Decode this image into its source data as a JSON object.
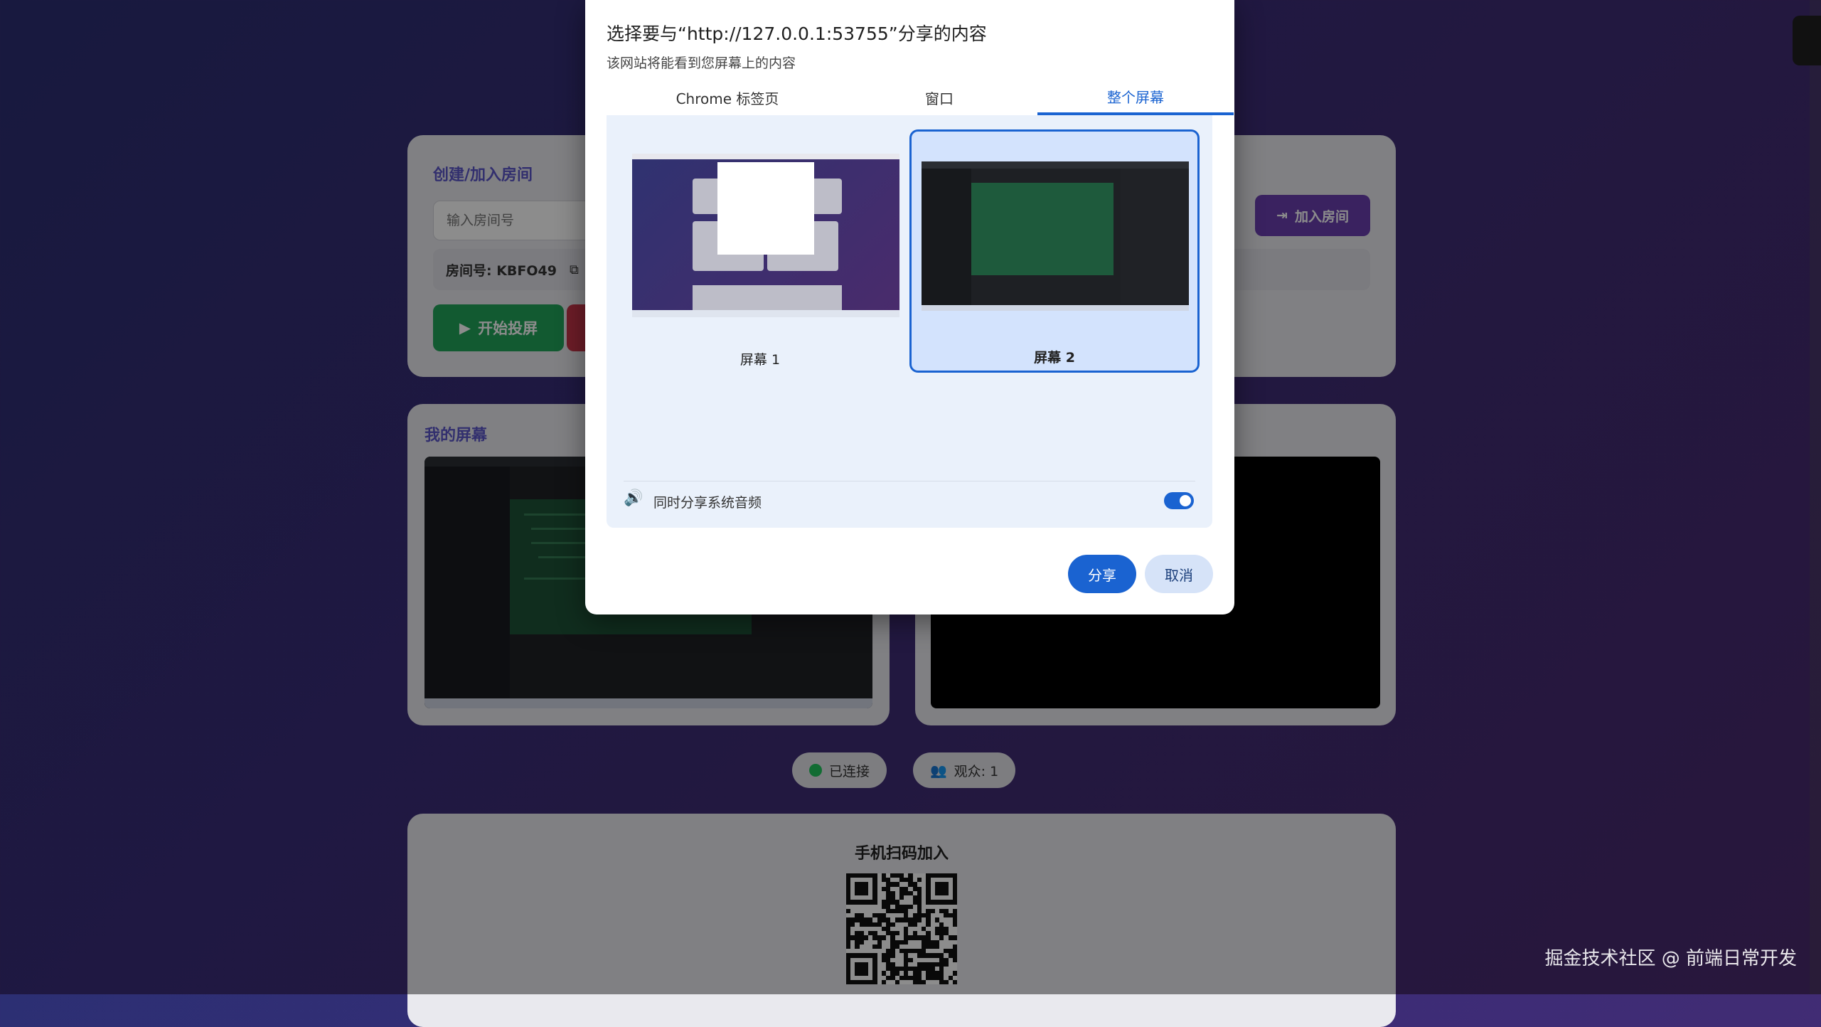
{
  "background_page": {
    "room_card": {
      "title": "创建/加入房间",
      "room_input_placeholder": "输入房间号",
      "join_button_label": "加入房间",
      "room_id_label": "房间号: KBFO49",
      "start_button_label": "开始投屏"
    },
    "my_screen_card": {
      "title": "我的屏幕"
    },
    "status": {
      "connected_label": "已连接",
      "viewers_label": "观众: 1"
    },
    "qr_card": {
      "title": "手机扫码加入"
    },
    "watermark": "掘金技术社区 @ 前端日常开发"
  },
  "dialog": {
    "title": "选择要与“http://127.0.0.1:53755”分享的内容",
    "subtitle": "该网站将能看到您屏幕上的内容",
    "tabs": [
      {
        "label": "Chrome 标签页",
        "active": false
      },
      {
        "label": "窗口",
        "active": false
      },
      {
        "label": "整个屏幕",
        "active": true
      }
    ],
    "screens": [
      {
        "label": "屏幕 1",
        "selected": false
      },
      {
        "label": "屏幕 2",
        "selected": true
      }
    ],
    "audio_label": "同时分享系统音频",
    "audio_enabled": true,
    "share_button": "分享",
    "cancel_button": "取消"
  },
  "colors": {
    "accent_blue": "#1a63d1",
    "start_green": "#22a45a",
    "join_purple": "#6a3fb0",
    "connected_dot": "#22c55e"
  }
}
